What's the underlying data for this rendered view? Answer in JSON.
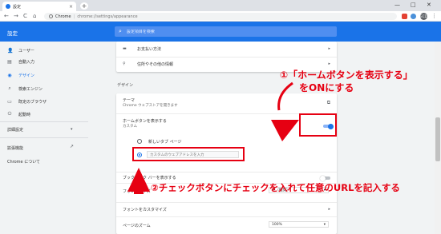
{
  "window": {
    "tab_title": "設定",
    "tab_close": "×",
    "new_tab": "+",
    "minimize": "—",
    "maximize": "□",
    "close": "✕"
  },
  "toolbar": {
    "back": "←",
    "forward": "→",
    "reload": "C",
    "home": "⌂",
    "omnibox_label": "Chrome",
    "omnibox_sep": "|",
    "omnibox_url": "chrome://settings/appearance",
    "profile_initials": "ECD",
    "menu": "⋮"
  },
  "header": {
    "title": "設定",
    "search_placeholder": "設定項目を検索"
  },
  "sidebar": {
    "items": [
      {
        "icon": "person-icon",
        "glyph": "👤",
        "label": "ユーザー"
      },
      {
        "icon": "autofill-icon",
        "glyph": "▤",
        "label": "自動入力"
      },
      {
        "icon": "palette-icon",
        "glyph": "◉",
        "label": "デザイン"
      },
      {
        "icon": "search-icon",
        "glyph": "⌕",
        "label": "検索エンジン"
      },
      {
        "icon": "browser-icon",
        "glyph": "▭",
        "label": "既定のブラウザ"
      },
      {
        "icon": "power-icon",
        "glyph": "⏻",
        "label": "起動時"
      }
    ],
    "advanced": "詳細設定",
    "advanced_arrow": "▾",
    "extensions": "拡張機能",
    "extensions_icon": "↗",
    "about": "Chrome について"
  },
  "main": {
    "top_rows": [
      {
        "icon": "▬",
        "label": "お支払い方法"
      },
      {
        "icon": "⚲",
        "label": "住所やその他の情報"
      }
    ],
    "design_heading": "デザイン",
    "theme_label": "テーマ",
    "theme_sub": "Chrome ウェブストアを開きます",
    "theme_icon": "⧉",
    "home_label": "ホームボタンを表示する",
    "home_sub": "カスタム",
    "radio_newtab": "新しいタブ ページ",
    "radio_custom": "カスタムのウェブアドレスを入力",
    "bookmarks_label": "ブックマーク バーを表示する",
    "font_size_label": "フォントサイズ",
    "font_size_value": "中（推奨）",
    "customize_fonts_label": "フォントをカスタマイズ",
    "zoom_label": "ページのズーム",
    "zoom_value": "100%",
    "chevron": "▸",
    "dropdown_arrow": "▾"
  },
  "annotations": {
    "step1_line1": "①「ホームボタンを表示する」",
    "step1_line2": "をONにする",
    "step2": "②チェックボタンにチェックを入れて任意のURLを記入する"
  },
  "colors": {
    "accent": "#1a73e8",
    "annotation_red": "#e60012"
  }
}
